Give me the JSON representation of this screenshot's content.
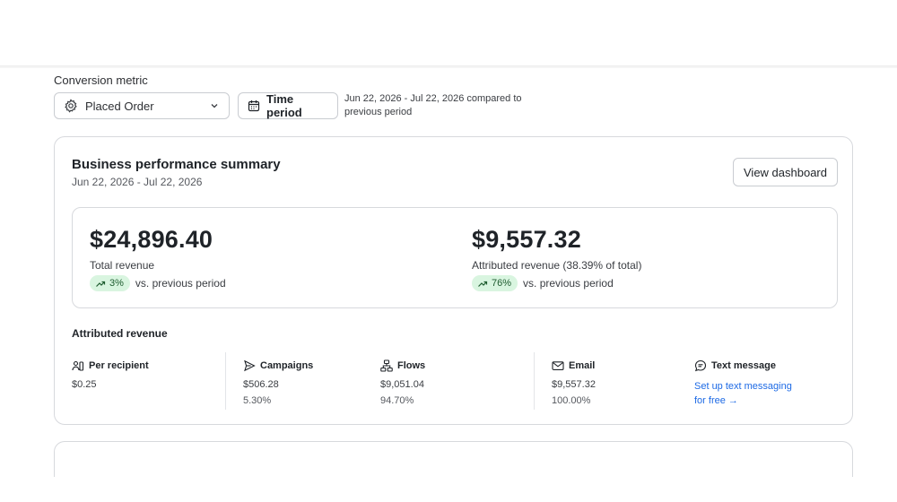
{
  "filters": {
    "conversion_metric_label": "Conversion metric",
    "metric_value": "Placed Order",
    "time_period_button": "Time period",
    "period_description": "Jun 22, 2026 - Jul 22, 2026 compared to previous period"
  },
  "summary": {
    "title": "Business performance summary",
    "date_range": "Jun 22, 2026 - Jul 22, 2026",
    "view_dashboard": "View dashboard",
    "total": {
      "amount": "$24,896.40",
      "label": "Total revenue",
      "change": "3%",
      "change_suffix": "vs. previous period"
    },
    "attributed": {
      "amount": "$9,557.32",
      "label": "Attributed revenue (38.39% of total)",
      "change": "76%",
      "change_suffix": "vs. previous period"
    }
  },
  "attributed_revenue": {
    "title": "Attributed revenue",
    "per_recipient": {
      "label": "Per recipient",
      "value": "$0.25",
      "icon": "users-icon"
    },
    "campaigns": {
      "label": "Campaigns",
      "value": "$506.28",
      "percent": "5.30%",
      "icon": "send-icon"
    },
    "flows": {
      "label": "Flows",
      "value": "$9,051.04",
      "percent": "94.70%",
      "icon": "flow-icon"
    },
    "email": {
      "label": "Email",
      "value": "$9,557.32",
      "percent": "100.00%",
      "icon": "mail-icon"
    },
    "text_message": {
      "label": "Text message",
      "link": "Set up text messaging for free →",
      "icon": "message-icon"
    }
  },
  "colors": {
    "badge_bg": "#d9f5e0",
    "badge_text": "#1e5c2f",
    "link": "#1d6ae5"
  }
}
